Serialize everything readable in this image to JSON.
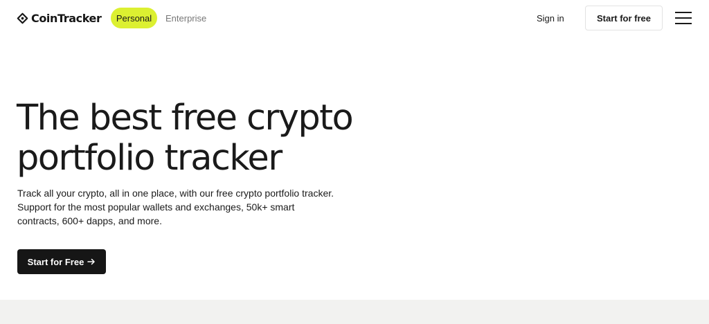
{
  "header": {
    "logo_text": "CoinTracker",
    "logo_icon": "cointracker-logo-icon",
    "nav": {
      "personal": "Personal",
      "enterprise": "Enterprise"
    },
    "sign_in": "Sign in",
    "cta": "Start for free",
    "menu_icon": "hamburger-menu-icon"
  },
  "hero": {
    "title_line1": "The best free crypto",
    "title_line2": "portfolio tracker",
    "subtitle_line1": "Track all your crypto, all in one place, with our free crypto portfolio tracker.",
    "subtitle_line2": "Support for the most popular wallets and exchanges, 50k+ smart",
    "subtitle_line3": "contracts, 600+ dapps, and more.",
    "cta": "Start for Free",
    "cta_icon": "arrow-right-icon"
  },
  "colors": {
    "accent": "#dcf031",
    "dark": "#161616",
    "muted_text": "#777777",
    "band": "#f2f2f0"
  }
}
